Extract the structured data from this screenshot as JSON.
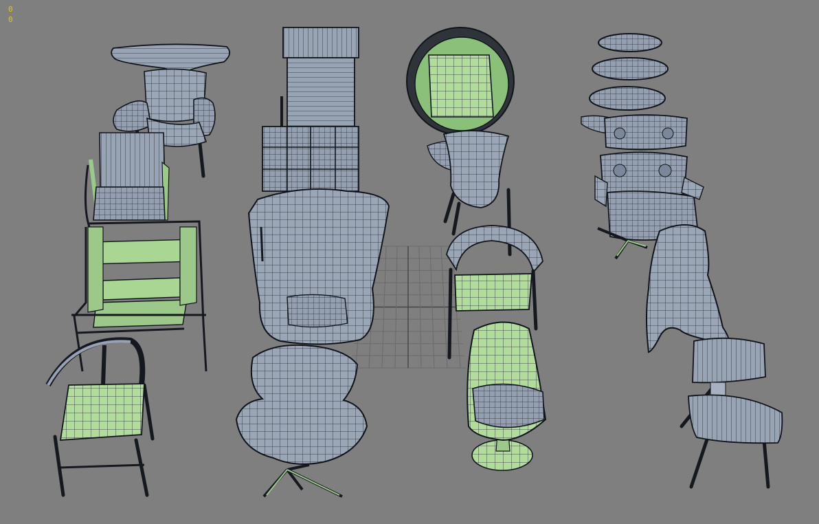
{
  "viewport": {
    "stats": [
      "0",
      "0"
    ]
  }
}
